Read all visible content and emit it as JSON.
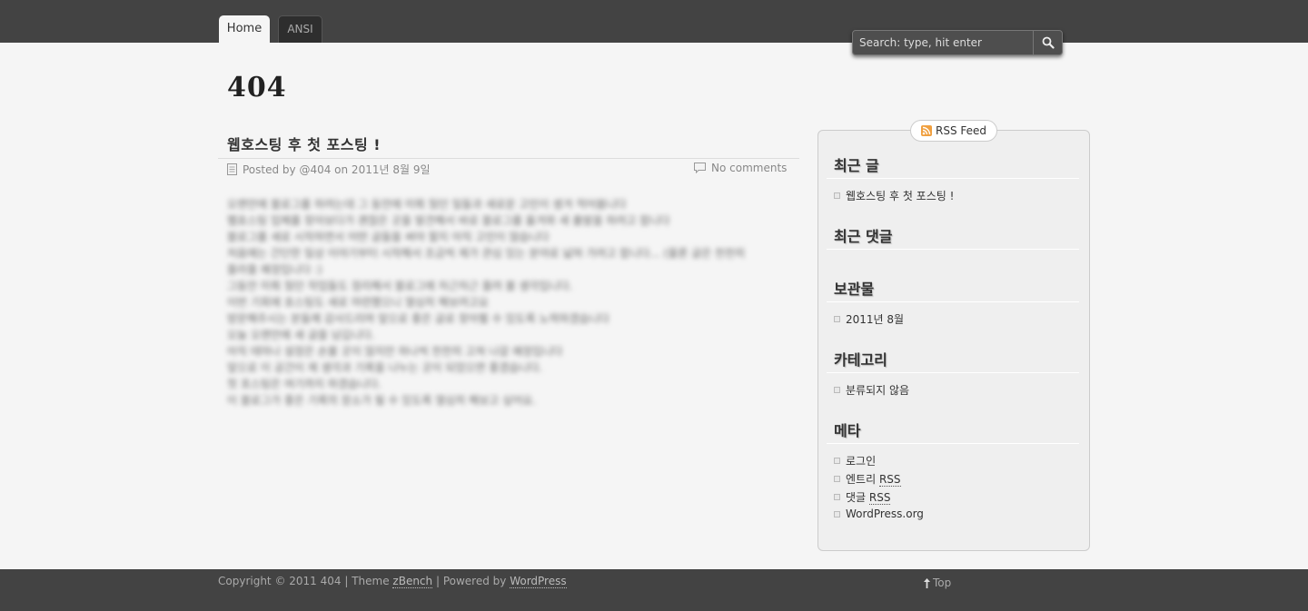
{
  "nav": {
    "tabs": [
      {
        "label": "Home",
        "active": true
      },
      {
        "label": "ANSI",
        "active": false
      }
    ]
  },
  "search": {
    "placeholder": "Search: type, hit enter",
    "icon": "search-icon"
  },
  "site": {
    "title": "404"
  },
  "post": {
    "title": "웹호스팅 후 첫 포스팅 !",
    "meta": "Posted by @404 on 2011년 8월 9일",
    "comments": "No comments",
    "body_lines": [
      "오랜만에 블로그를 하려는데 그 동안에 미뤄 뒀던 일들과 새로운 고민이 생겨 적어봅니다",
      "웹호스팅 업체를 찾아보다가 괜찮은 곳을 발견해서 바로 블로그를 옮겨와 새 출발을 하려고 합니다",
      "블로그를 새로 시작하면서 어떤 글들을 써야 할지 아직 고민이 많습니다",
      "처음에는 간단한 일상 이야기부터 시작해서 조금씩 제가 관심 있는 분야로 넓혀 가려고 합니다... (물론 글은 천천히",
      "올라올 예정입니다 :)",
      "그동안 미뤄 뒀던 작업들도 정리해서 블로그에 차근차근 올려 볼 생각입니다.",
      "이번 기회에 호스팅도 새로 마련했으니 열심히 해보려고요",
      "방문해주시는 분들께 감사드리며 앞으로 좋은 글로 찾아뵐 수 있도록 노력하겠습니다",
      "오늘 오랜만에 새 글을 남깁니다.",
      "아직 테마나 설정은 손볼 곳이 많지만 하나씩 천천히 고쳐 나갈 예정입니다",
      "앞으로 이 공간이 제 생각과 기록을 나누는 곳이 되었으면 좋겠습니다.",
      "첫 포스팅은 여기까지 하겠습니다.",
      "이 블로그가 좋은 기록의 장소가 될 수 있도록 열심히 해보고 싶어요."
    ]
  },
  "sidebar": {
    "rss_label": "RSS Feed",
    "recent_posts_title": "최근 글",
    "recent_posts": [
      "웹호스팅 후 첫 포스팅 !"
    ],
    "recent_comments_title": "최근 댓글",
    "archives_title": "보관물",
    "archives": [
      "2011년 8월"
    ],
    "categories_title": "카테고리",
    "categories": [
      "분류되지 않음"
    ],
    "meta_title": "메타",
    "meta_items": {
      "login": "로그인",
      "entries_prefix": "엔트리 ",
      "entries_rss": "RSS",
      "comments_prefix": "댓글 ",
      "comments_rss": "RSS",
      "wordpress": "WordPress.org"
    }
  },
  "footer": {
    "copyright": "Copyright © 2011 404 | Theme ",
    "theme_link": "zBench",
    "powered_prefix": " | Powered by ",
    "powered_link": "WordPress",
    "top_label": "Top"
  }
}
